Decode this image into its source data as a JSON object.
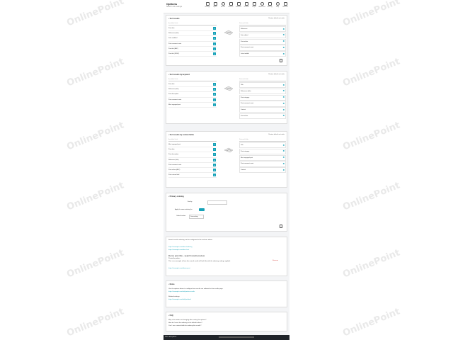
{
  "watermark": "OnlinePoint",
  "page": {
    "title": "Options",
    "subtitle": "Search Ads settings"
  },
  "toolbar": {
    "items": [
      {
        "label": "Settings",
        "icon": "wrench-icon"
      },
      {
        "label": "Styles",
        "icon": "brush-icon"
      },
      {
        "label": "Search",
        "icon": "search-icon"
      },
      {
        "label": "Indexes",
        "icon": "folder-icon"
      },
      {
        "label": "Statistics",
        "icon": "chart-icon"
      },
      {
        "label": "Themes",
        "icon": "monitor-icon"
      },
      {
        "label": "Pages",
        "icon": "page-icon"
      },
      {
        "label": "Advanced",
        "icon": "gear-icon"
      },
      {
        "label": "Sharing",
        "icon": "share-icon"
      },
      {
        "label": "Help",
        "icon": "help-icon"
      },
      {
        "label": "Multisite",
        "icon": "pin-icon"
      }
    ]
  },
  "sections": [
    {
      "title": "Sort results",
      "link": "Restore default sort order",
      "left_header": "Available fields",
      "left": [
        "Post date",
        "Relevance (title)",
        "Date modified",
        "Post comment count",
        "Post title (ASC)",
        "Post title (DESC)"
      ],
      "right_header": "Selected fields",
      "right": [
        "Relevance",
        "Date added",
        "Post author",
        "Post comment count",
        "Latest added"
      ]
    },
    {
      "title": "Sort results by keyword",
      "link": "Restore default sort order",
      "left_header": "Available fields",
      "left": [
        "Post date",
        "Relevance (title)",
        "Post description",
        "Post comment count",
        "Most engaged post"
      ],
      "right_header": "Selected fields",
      "right": [
        "Title",
        "Relevance (title)",
        "Post category",
        "Post comment count",
        "Content",
        "Post author"
      ]
    },
    {
      "title": "Sort results by custom fields",
      "link": "Restore default sort order",
      "left_header": "Available fields",
      "left": [
        "Most engaged post",
        "Post date",
        "Post description",
        "Relevance (title)",
        "Post comment count",
        "Post author (ASC)",
        "Post custom field"
      ],
      "right_header": "Selected fields",
      "right": [
        "Title",
        "Post category",
        "Most engaged post",
        "Post comment count",
        "Content"
      ]
    }
  ],
  "primary": {
    "title": "Primary ordering",
    "fields": [
      {
        "label": "Sort by"
      },
      {
        "label": "Apply the same ordering for"
      },
      {
        "label": "Order direction"
      }
    ],
    "select_value": "Descending"
  },
  "info": {
    "text": "Search results ordering can be configured in the sections above.",
    "links": [
      "https://example.com/docs/ordering",
      "https://example.com/docs/sort"
    ],
    "result_title": "Demo post title - search result preview",
    "result_meta": "Posted by admin",
    "result_desc": "This is an example of how the search result will look like with the ordering settings applied.",
    "result_link": "https://example.com/demo-post",
    "remove": "Remove"
  },
  "notes": {
    "title": "Notes",
    "text1": "Use the options above to configure how results are ordered on the results page.",
    "link1": "https://example.com/help/order-results",
    "text2": "Related settings",
    "link2": "https://example.com/help/related"
  },
  "faq": {
    "title": "FAQ",
    "q1": "Why is the order not changing after saving the options?",
    "q2": "How do I reset the ordering to the default values?",
    "q3": "Can I use custom fields for ordering the results?"
  },
  "footer": {
    "save": "Save all options"
  }
}
